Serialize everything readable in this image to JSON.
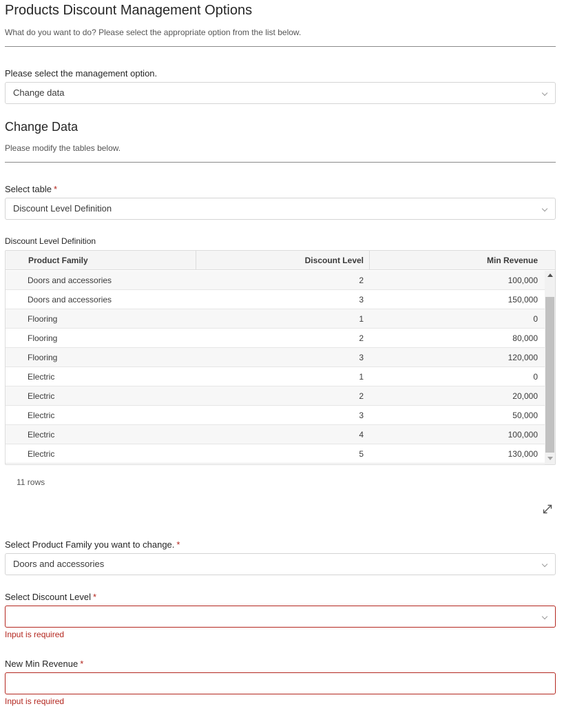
{
  "page": {
    "title": "Products Discount Management Options",
    "subtitle": "What do you want to do? Please select the appropriate option from the list below."
  },
  "management_option": {
    "label": "Please select the management option.",
    "value": "Change data"
  },
  "change_data": {
    "title": "Change Data",
    "subtitle": "Please modify the tables below."
  },
  "select_table": {
    "label": "Select table",
    "required_mark": "*",
    "value": "Discount Level Definition"
  },
  "table": {
    "caption": "Discount Level Definition",
    "columns": [
      "Product Family",
      "Discount Level",
      "Min Revenue"
    ],
    "rows": [
      [
        "Doors and accessories",
        "2",
        "100,000"
      ],
      [
        "Doors and accessories",
        "3",
        "150,000"
      ],
      [
        "Flooring",
        "1",
        "0"
      ],
      [
        "Flooring",
        "2",
        "80,000"
      ],
      [
        "Flooring",
        "3",
        "120,000"
      ],
      [
        "Electric",
        "1",
        "0"
      ],
      [
        "Electric",
        "2",
        "20,000"
      ],
      [
        "Electric",
        "3",
        "50,000"
      ],
      [
        "Electric",
        "4",
        "100,000"
      ],
      [
        "Electric",
        "5",
        "130,000"
      ]
    ],
    "row_count": "11 rows",
    "expand_icon": "expand-diagonal-icon"
  },
  "product_family_select": {
    "label": "Select Product Family you want to change.",
    "required_mark": "*",
    "value": "Doors and accessories"
  },
  "discount_level_select": {
    "label": "Select Discount Level",
    "required_mark": "*",
    "value": "",
    "error": "Input is required"
  },
  "new_min_revenue": {
    "label": "New Min Revenue",
    "required_mark": "*",
    "value": "",
    "error": "Input is required"
  },
  "colors": {
    "error": "#b3261e",
    "border": "#d4d4d4"
  }
}
